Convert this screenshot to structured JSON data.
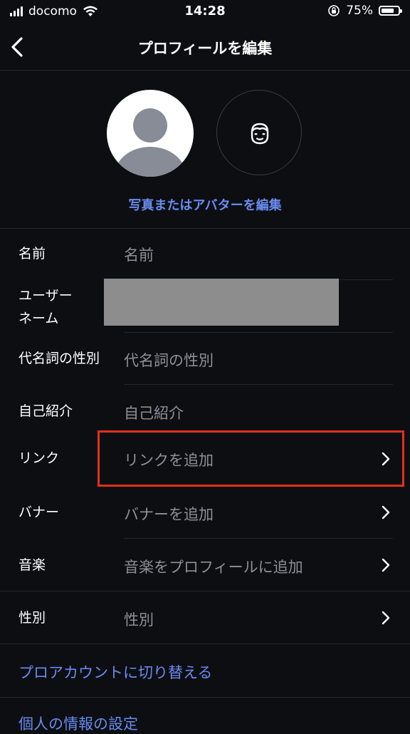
{
  "status_bar": {
    "carrier": "docomo",
    "time": "14:28",
    "battery_percent": "75%",
    "battery_level": 0.75
  },
  "nav": {
    "title": "プロフィールを編集",
    "back_icon": "chevron-left-icon"
  },
  "avatar_section": {
    "edit_link": "写真またはアバターを編集",
    "avatar_icon": "default-avatar-icon",
    "alt_avatar_icon": "avatar-face-icon"
  },
  "fields": {
    "name": {
      "label": "名前",
      "placeholder": "名前"
    },
    "username": {
      "label_line1": "ユーザー",
      "label_line2": "ネーム",
      "value": ""
    },
    "pronouns": {
      "label": "代名詞の性別",
      "placeholder": "代名詞の性別"
    },
    "bio": {
      "label": "自己紹介",
      "placeholder": "自己紹介"
    },
    "links": {
      "label": "リンク",
      "value": "リンクを追加"
    },
    "banner": {
      "label": "バナー",
      "value": "バナーを追加"
    },
    "music": {
      "label": "音楽",
      "value": "音楽をプロフィールに追加"
    },
    "gender": {
      "label": "性別",
      "value": "性別"
    }
  },
  "links": {
    "pro_account": "プロアカウントに切り替える",
    "personal_info": "個人の情報の設定"
  },
  "colors": {
    "background": "#0c0e12",
    "accent_link": "#6a8bf0",
    "highlight": "#e32f1c",
    "placeholder_text": "#8c9098"
  }
}
